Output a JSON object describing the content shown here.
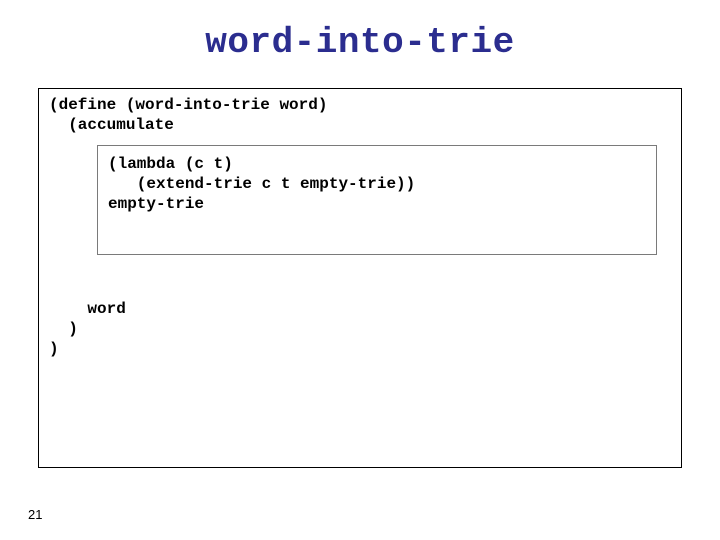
{
  "title": "word-into-trie",
  "code": {
    "top": "(define (word-into-trie word)\n  (accumulate",
    "inner": "(lambda (c t)\n   (extend-trie c t empty-trie))\nempty-trie",
    "bottom": "    word\n  )\n)"
  },
  "pageNumber": "21"
}
